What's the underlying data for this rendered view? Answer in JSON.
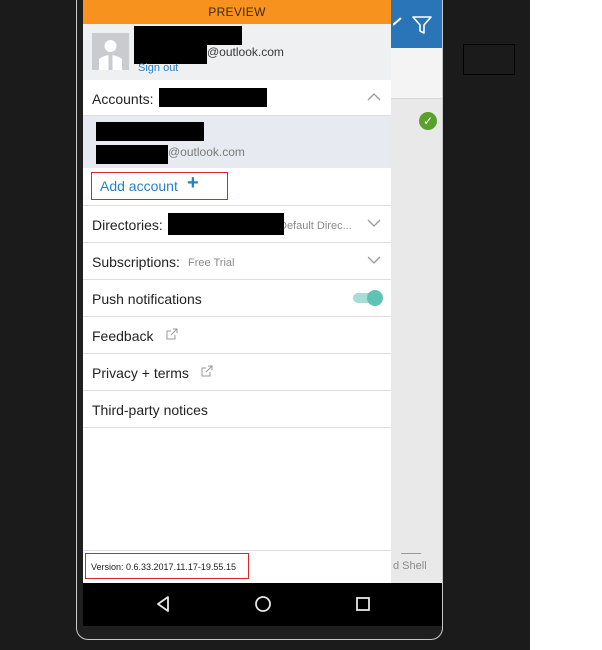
{
  "preview_label": "PREVIEW",
  "profile": {
    "email_suffix": "@outlook.com",
    "sign_out_label": "Sign out"
  },
  "accounts": {
    "label": "Accounts:",
    "item_email_suffix": "@outlook.com",
    "add_label": "Add account",
    "add_icon": "+"
  },
  "directories": {
    "label": "Directories:",
    "value": "Default Direc..."
  },
  "subscriptions": {
    "label": "Subscriptions:",
    "value": "Free Trial"
  },
  "push_notifications": {
    "label": "Push notifications",
    "enabled": true
  },
  "feedback": {
    "label": "Feedback"
  },
  "privacy": {
    "label": "Privacy + terms"
  },
  "third_party": {
    "label": "Third-party notices"
  },
  "version": {
    "text": "Version: 0.6.33.2017.11.17-19.55.15"
  },
  "background_app": {
    "nav_text": "d Shell"
  },
  "colors": {
    "preview_bar": "#f7921e",
    "link_blue": "#2a7fc4",
    "highlight_red": "#d9262c",
    "toggle_teal": "#5ec2b6",
    "app_header": "#2a74b8"
  },
  "icons": {
    "filter": "filter-icon",
    "check": "check-circle-icon",
    "chevron": "chevron-down-icon",
    "chevron_up": "chevron-up-icon",
    "external": "external-link-icon",
    "back": "back-triangle-icon",
    "home": "home-circle-icon",
    "recents": "recents-square-icon"
  }
}
